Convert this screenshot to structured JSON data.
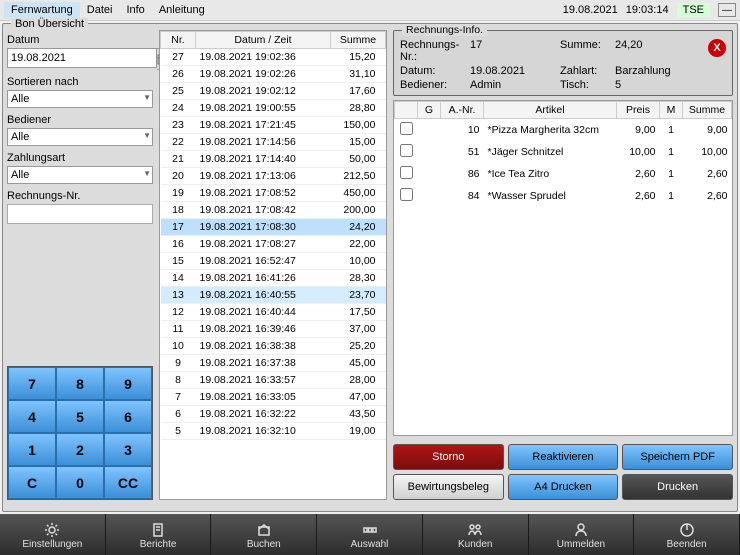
{
  "menubar": {
    "items": [
      "Fernwartung",
      "Datei",
      "Info",
      "Anleitung"
    ],
    "date": "19.08.2021",
    "time": "19:03:14",
    "tse": "TSE"
  },
  "panel_title": "Bon Übersicht",
  "filters": {
    "date_label": "Datum",
    "date_value": "19.08.2021",
    "sort_label": "Sortieren nach",
    "sort_value": "Alle",
    "bediener_label": "Bediener",
    "bediener_value": "Alle",
    "zahlart_label": "Zahlungsart",
    "zahlart_value": "Alle",
    "rnr_label": "Rechnungs-Nr."
  },
  "keypad": [
    "7",
    "8",
    "9",
    "4",
    "5",
    "6",
    "1",
    "2",
    "3",
    "C",
    "0",
    "CC"
  ],
  "grid": {
    "head": [
      "Nr.",
      "Datum / Zeit",
      "Summe"
    ],
    "rows": [
      {
        "nr": "27",
        "dt": "19.08.2021 19:02:36",
        "sum": "15,20"
      },
      {
        "nr": "26",
        "dt": "19.08.2021 19:02:26",
        "sum": "31,10"
      },
      {
        "nr": "25",
        "dt": "19.08.2021 19:02:12",
        "sum": "17,60"
      },
      {
        "nr": "24",
        "dt": "19.08.2021 19:00:55",
        "sum": "28,80"
      },
      {
        "nr": "23",
        "dt": "19.08.2021 17:21:45",
        "sum": "150,00"
      },
      {
        "nr": "22",
        "dt": "19.08.2021 17:14:56",
        "sum": "15,00"
      },
      {
        "nr": "21",
        "dt": "19.08.2021 17:14:40",
        "sum": "50,00"
      },
      {
        "nr": "20",
        "dt": "19.08.2021 17:13:06",
        "sum": "212,50"
      },
      {
        "nr": "19",
        "dt": "19.08.2021 17:08:52",
        "sum": "450,00"
      },
      {
        "nr": "18",
        "dt": "19.08.2021 17:08:42",
        "sum": "200,00"
      },
      {
        "nr": "17",
        "dt": "19.08.2021 17:08:30",
        "sum": "24,20",
        "sel": true
      },
      {
        "nr": "16",
        "dt": "19.08.2021 17:08:27",
        "sum": "22,00"
      },
      {
        "nr": "15",
        "dt": "19.08.2021 16:52:47",
        "sum": "10,00"
      },
      {
        "nr": "14",
        "dt": "19.08.2021 16:41:26",
        "sum": "28,30"
      },
      {
        "nr": "13",
        "dt": "19.08.2021 16:40:55",
        "sum": "23,70",
        "sel2": true
      },
      {
        "nr": "12",
        "dt": "19.08.2021 16:40:44",
        "sum": "17,50"
      },
      {
        "nr": "11",
        "dt": "19.08.2021 16:39:46",
        "sum": "37,00"
      },
      {
        "nr": "10",
        "dt": "19.08.2021 16:38:38",
        "sum": "25,20"
      },
      {
        "nr": "9",
        "dt": "19.08.2021 16:37:38",
        "sum": "45,00"
      },
      {
        "nr": "8",
        "dt": "19.08.2021 16:33:57",
        "sum": "28,00"
      },
      {
        "nr": "7",
        "dt": "19.08.2021 16:33:05",
        "sum": "47,00"
      },
      {
        "nr": "6",
        "dt": "19.08.2021 16:32:22",
        "sum": "43,50"
      },
      {
        "nr": "5",
        "dt": "19.08.2021 16:32:10",
        "sum": "19,00"
      }
    ]
  },
  "info": {
    "title": "Rechnungs-Info.",
    "rnr_label": "Rechnungs-Nr.:",
    "rnr": "17",
    "summe_label": "Summe:",
    "summe": "24,20",
    "datum_label": "Datum:",
    "datum": "19.08.2021",
    "zahlart_label": "Zahlart:",
    "zahlart": "Barzahlung",
    "bediener_label": "Bediener:",
    "bediener": "Admin",
    "tisch_label": "Tisch:",
    "tisch": "5"
  },
  "items": {
    "head": [
      "",
      "G",
      "A.-Nr.",
      "Artikel",
      "Preis",
      "M",
      "Summe"
    ],
    "rows": [
      {
        "anr": "10",
        "art": "*Pizza Margherita 32cm",
        "preis": "9,00",
        "m": "1",
        "sum": "9,00"
      },
      {
        "anr": "51",
        "art": "*Jäger Schnitzel",
        "preis": "10,00",
        "m": "1",
        "sum": "10,00"
      },
      {
        "anr": "86",
        "art": "*Ice Tea Zitro",
        "preis": "2,60",
        "m": "1",
        "sum": "2,60"
      },
      {
        "anr": "84",
        "art": "*Wasser Sprudel",
        "preis": "2,60",
        "m": "1",
        "sum": "2,60"
      }
    ]
  },
  "actions": {
    "storno": "Storno",
    "reakt": "Reaktivieren",
    "pdf": "Speichern PDF",
    "bewirt": "Bewirtungsbeleg",
    "a4": "A4 Drucken",
    "drucken": "Drucken"
  },
  "bottombar": [
    "Einstellungen",
    "Berichte",
    "Buchen",
    "Auswahl",
    "Kunden",
    "Ummelden",
    "Beenden"
  ]
}
